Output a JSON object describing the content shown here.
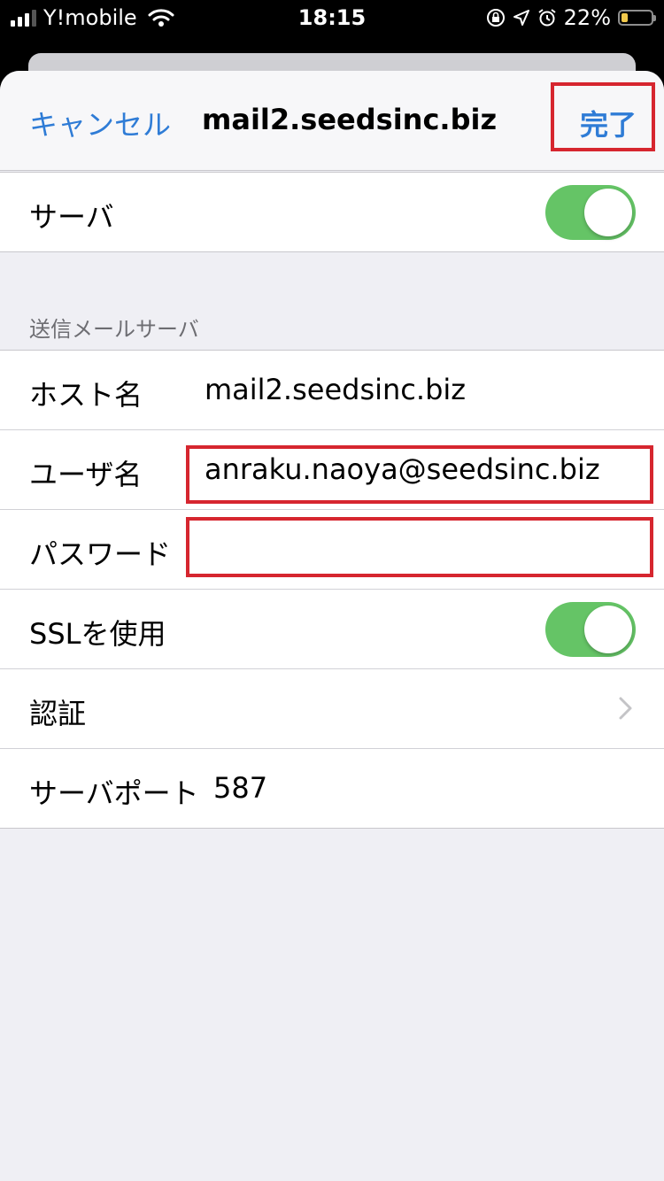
{
  "status_bar": {
    "carrier": "Y!mobile",
    "time": "18:15",
    "battery_percent": "22%",
    "icons": [
      "signal-icon",
      "wifi-icon",
      "orientation-lock-icon",
      "location-icon",
      "alarm-icon",
      "battery-icon"
    ],
    "battery_level": 0.22,
    "battery_color": "#f2c94c"
  },
  "nav": {
    "cancel_label": "キャンセル",
    "title": "mail2.seedsinc.biz",
    "done_label": "完了"
  },
  "server_group": {
    "label": "サーバ",
    "toggle_on": true
  },
  "outgoing": {
    "section_header": "送信メールサーバ",
    "host_label": "ホスト名",
    "host_value": "mail2.seedsinc.biz",
    "user_label": "ユーザ名",
    "user_value": "anraku.naoya@seedsinc.biz",
    "password_label": "パスワード",
    "password_value": "",
    "ssl_label": "SSLを使用",
    "ssl_on": true,
    "auth_label": "認証",
    "port_label": "サーバポート",
    "port_value": "587"
  },
  "colors": {
    "accent": "#2f7cd6",
    "toggle_on": "#65c466",
    "highlight": "#d6262f",
    "background": "#efeff4"
  }
}
